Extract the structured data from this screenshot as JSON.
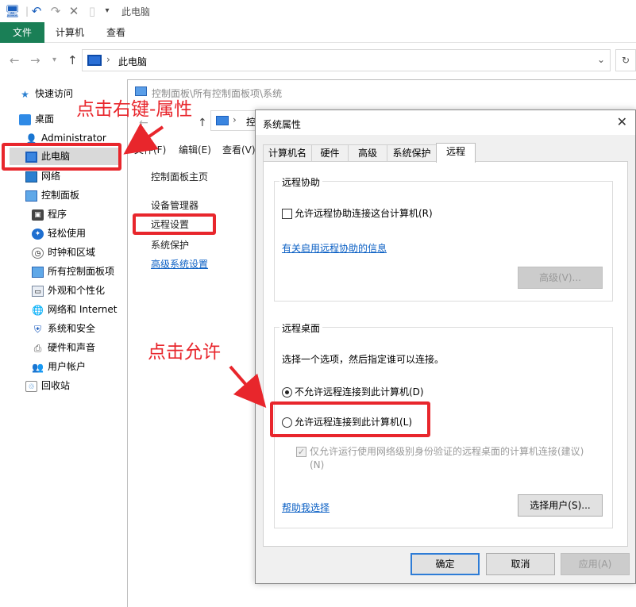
{
  "window": {
    "title": "此电脑"
  },
  "ribbon": {
    "file_tab": "文件",
    "tabs": [
      "计算机",
      "查看"
    ]
  },
  "address": {
    "path": "此电脑",
    "separator": "›"
  },
  "sidebar": {
    "items": [
      {
        "label": "快速访问",
        "icon": "star-icon"
      },
      {
        "label": "桌面",
        "icon": "desktop-icon"
      },
      {
        "label": "Administrator",
        "icon": "user-icon"
      },
      {
        "label": "此电脑",
        "icon": "computer-icon"
      },
      {
        "label": "网络",
        "icon": "network-icon"
      },
      {
        "label": "控制面板",
        "icon": "control-panel-icon"
      },
      {
        "label": "程序",
        "icon": "programs-icon"
      },
      {
        "label": "轻松使用",
        "icon": "ease-of-access-icon"
      },
      {
        "label": "时钟和区域",
        "icon": "clock-icon"
      },
      {
        "label": "所有控制面板项",
        "icon": "control-panel-icon"
      },
      {
        "label": "外观和个性化",
        "icon": "appearance-icon"
      },
      {
        "label": "网络和 Internet",
        "icon": "globe-icon"
      },
      {
        "label": "系统和安全",
        "icon": "shield-icon"
      },
      {
        "label": "硬件和声音",
        "icon": "printer-icon"
      },
      {
        "label": "用户帐户",
        "icon": "users-icon"
      },
      {
        "label": "回收站",
        "icon": "recycle-bin-icon"
      }
    ]
  },
  "control_panel": {
    "title": "控制面板\\所有控制面板项\\系统",
    "address_short": "控",
    "menu": [
      "文件(F)",
      "编辑(E)",
      "查看(V)"
    ],
    "links": [
      "控制面板主页",
      "设备管理器",
      "远程设置",
      "系统保护",
      "高级系统设置"
    ]
  },
  "dialog": {
    "title": "系统属性",
    "tabs": [
      "计算机名",
      "硬件",
      "高级",
      "系统保护",
      "远程"
    ],
    "active_tab": "远程",
    "remote_assistance": {
      "group_title": "远程协助",
      "checkbox_label": "允许远程协助连接这台计算机(R)",
      "checked": false,
      "info_link": "有关启用远程协助的信息",
      "advanced_button": "高级(V)..."
    },
    "remote_desktop": {
      "group_title": "远程桌面",
      "instruction": "选择一个选项，然后指定谁可以连接。",
      "option_deny": "不允许远程连接到此计算机(D)",
      "option_allow": "允许远程连接到此计算机(L)",
      "selected": "deny",
      "nla_label": "仅允许运行使用网络级别身份验证的远程桌面的计算机连接(建议)",
      "nla_label_suffix": "(N)",
      "help_link": "帮助我选择",
      "select_users_button": "选择用户(S)..."
    },
    "buttons": {
      "ok": "确定",
      "cancel": "取消",
      "apply": "应用(A)"
    }
  },
  "annotations": {
    "right_click": "点击右键-属性",
    "click_allow": "点击允许",
    "color": "#e8262c"
  }
}
